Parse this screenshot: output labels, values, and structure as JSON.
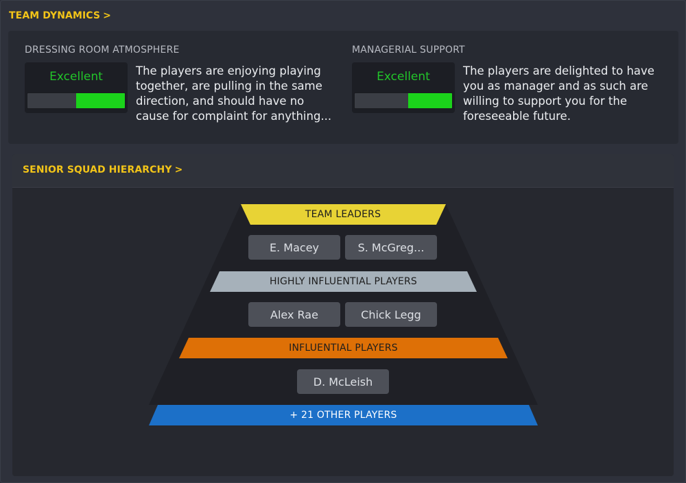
{
  "team_dynamics": {
    "header": "TEAM DYNAMICS",
    "chevron": ">",
    "dressing_room": {
      "title": "DRESSING ROOM ATMOSPHERE",
      "rating": "Excellent",
      "level": 0.5,
      "description_lines": [
        "The players are enjoying playing",
        "together, are pulling in the same",
        "direction, and should have no",
        "cause for complaint for anything..."
      ]
    },
    "managerial_support": {
      "title": "MANAGERIAL SUPPORT",
      "rating": "Excellent",
      "level": 0.45,
      "description_lines": [
        "The players are delighted to have",
        "you as manager and as such are",
        "willing to support you for the",
        "foreseeable future."
      ]
    }
  },
  "hierarchy": {
    "header": "SENIOR SQUAD HIERARCHY",
    "chevron": ">",
    "tiers": [
      {
        "label": "TEAM LEADERS",
        "color": "#e8d335",
        "text_color": "#1d1d1d",
        "players": [
          "E. Macey",
          "S. McGreg..."
        ]
      },
      {
        "label": "HIGHLY INFLUENTIAL PLAYERS",
        "color": "#a6b1ba",
        "text_color": "#1d1d1d",
        "players": [
          "Alex Rae",
          "Chick Legg"
        ]
      },
      {
        "label": "INFLUENTIAL PLAYERS",
        "color": "#de7006",
        "text_color": "#1d1d1d",
        "players": [
          "D. McLeish"
        ]
      }
    ],
    "other_players": {
      "label": "+ 21 OTHER PLAYERS",
      "color": "#1c70c8",
      "text_color": "#ffffff"
    }
  },
  "colors": {
    "accent": "#f2c418",
    "rating_good": "#22c52a",
    "bar_fill": "#1bd31b"
  }
}
